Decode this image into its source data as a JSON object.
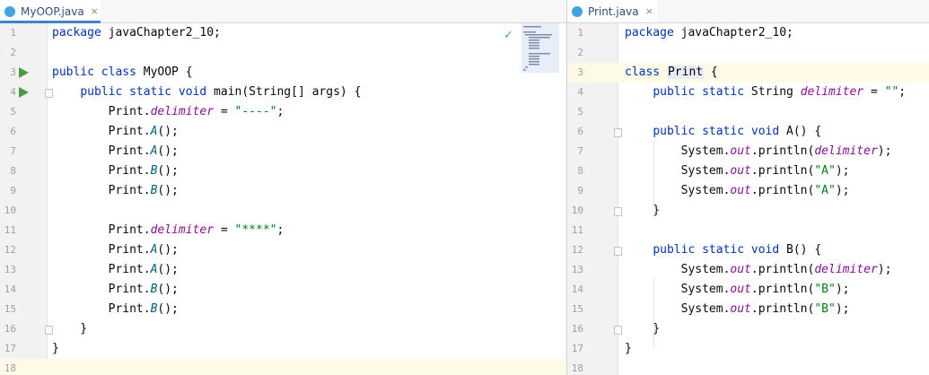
{
  "left_tab": {
    "filename": "MyOOP.java",
    "close": "×"
  },
  "right_tab": {
    "filename": "Print.java",
    "close": "×"
  },
  "left_editor": {
    "status": "✓",
    "lines": [
      {
        "n": "1",
        "tokens": [
          [
            "kw",
            "package "
          ],
          [
            "plain",
            "javaChapter2_10;"
          ]
        ]
      },
      {
        "n": "2",
        "tokens": []
      },
      {
        "n": "3",
        "run": true,
        "tokens": [
          [
            "kw",
            "public class "
          ],
          [
            "plain",
            "MyOOP {"
          ]
        ]
      },
      {
        "n": "4",
        "run": true,
        "fold": true,
        "tokens": [
          [
            "plain",
            "    "
          ],
          [
            "kw",
            "public static void "
          ],
          [
            "plain",
            "main(String[] args) {"
          ]
        ]
      },
      {
        "n": "5",
        "tokens": [
          [
            "plain",
            "        Print."
          ],
          [
            "fld",
            "delimiter"
          ],
          [
            "plain",
            " = "
          ],
          [
            "str",
            "\"----\""
          ],
          [
            "plain",
            ";"
          ]
        ]
      },
      {
        "n": "6",
        "tokens": [
          [
            "plain",
            "        Print."
          ],
          [
            "mcall",
            "A"
          ],
          [
            "plain",
            "();"
          ]
        ]
      },
      {
        "n": "7",
        "tokens": [
          [
            "plain",
            "        Print."
          ],
          [
            "mcall",
            "A"
          ],
          [
            "plain",
            "();"
          ]
        ]
      },
      {
        "n": "8",
        "tokens": [
          [
            "plain",
            "        Print."
          ],
          [
            "mcall",
            "B"
          ],
          [
            "plain",
            "();"
          ]
        ]
      },
      {
        "n": "9",
        "tokens": [
          [
            "plain",
            "        Print."
          ],
          [
            "mcall",
            "B"
          ],
          [
            "plain",
            "();"
          ]
        ]
      },
      {
        "n": "10",
        "tokens": []
      },
      {
        "n": "11",
        "tokens": [
          [
            "plain",
            "        Print."
          ],
          [
            "fld",
            "delimiter"
          ],
          [
            "plain",
            " = "
          ],
          [
            "str",
            "\"****\""
          ],
          [
            "plain",
            ";"
          ]
        ]
      },
      {
        "n": "12",
        "tokens": [
          [
            "plain",
            "        Print."
          ],
          [
            "mcall",
            "A"
          ],
          [
            "plain",
            "();"
          ]
        ]
      },
      {
        "n": "13",
        "tokens": [
          [
            "plain",
            "        Print."
          ],
          [
            "mcall",
            "A"
          ],
          [
            "plain",
            "();"
          ]
        ]
      },
      {
        "n": "14",
        "tokens": [
          [
            "plain",
            "        Print."
          ],
          [
            "mcall",
            "B"
          ],
          [
            "plain",
            "();"
          ]
        ]
      },
      {
        "n": "15",
        "tokens": [
          [
            "plain",
            "        Print."
          ],
          [
            "mcall",
            "B"
          ],
          [
            "plain",
            "();"
          ]
        ]
      },
      {
        "n": "16",
        "fold": true,
        "tokens": [
          [
            "plain",
            "    }"
          ]
        ]
      },
      {
        "n": "17",
        "tokens": [
          [
            "plain",
            "}"
          ]
        ]
      },
      {
        "n": "18",
        "current": true,
        "tokens": []
      }
    ]
  },
  "right_editor": {
    "lines": [
      {
        "n": "1",
        "tokens": [
          [
            "kw",
            "package "
          ],
          [
            "plain",
            "javaChapter2_10;"
          ]
        ]
      },
      {
        "n": "2",
        "tokens": []
      },
      {
        "n": "3",
        "current": true,
        "tokens": [
          [
            "kw",
            "class "
          ],
          [
            "cls",
            "Print"
          ],
          [
            "plain",
            " {"
          ]
        ]
      },
      {
        "n": "4",
        "tokens": [
          [
            "plain",
            "    "
          ],
          [
            "kw",
            "public static "
          ],
          [
            "plain",
            "String "
          ],
          [
            "fld",
            "delimiter"
          ],
          [
            "plain",
            " = "
          ],
          [
            "str",
            "\"\""
          ],
          [
            "plain",
            ";"
          ]
        ]
      },
      {
        "n": "5",
        "tokens": []
      },
      {
        "n": "6",
        "fold": true,
        "tokens": [
          [
            "plain",
            "    "
          ],
          [
            "kw",
            "public static void "
          ],
          [
            "plain",
            "A() {"
          ]
        ]
      },
      {
        "n": "7",
        "tokens": [
          [
            "plain",
            "        System."
          ],
          [
            "fld",
            "out"
          ],
          [
            "plain",
            ".println("
          ],
          [
            "fld",
            "delimiter"
          ],
          [
            "plain",
            ");"
          ]
        ]
      },
      {
        "n": "8",
        "tokens": [
          [
            "plain",
            "        System."
          ],
          [
            "fld",
            "out"
          ],
          [
            "plain",
            ".println("
          ],
          [
            "str",
            "\"A\""
          ],
          [
            "plain",
            ");"
          ]
        ]
      },
      {
        "n": "9",
        "tokens": [
          [
            "plain",
            "        System."
          ],
          [
            "fld",
            "out"
          ],
          [
            "plain",
            ".println("
          ],
          [
            "str",
            "\"A\""
          ],
          [
            "plain",
            ");"
          ]
        ]
      },
      {
        "n": "10",
        "fold": true,
        "tokens": [
          [
            "plain",
            "    }"
          ]
        ]
      },
      {
        "n": "11",
        "tokens": []
      },
      {
        "n": "12",
        "fold": true,
        "tokens": [
          [
            "plain",
            "    "
          ],
          [
            "kw",
            "public static void "
          ],
          [
            "plain",
            "B() {"
          ]
        ]
      },
      {
        "n": "13",
        "tokens": [
          [
            "plain",
            "        System."
          ],
          [
            "fld",
            "out"
          ],
          [
            "plain",
            ".println("
          ],
          [
            "fld",
            "delimiter"
          ],
          [
            "plain",
            ");"
          ]
        ]
      },
      {
        "n": "14",
        "tokens": [
          [
            "plain",
            "        System."
          ],
          [
            "fld",
            "out"
          ],
          [
            "plain",
            ".println("
          ],
          [
            "str",
            "\"B\""
          ],
          [
            "plain",
            ");"
          ]
        ]
      },
      {
        "n": "15",
        "tokens": [
          [
            "plain",
            "        System."
          ],
          [
            "fld",
            "out"
          ],
          [
            "plain",
            ".println("
          ],
          [
            "str",
            "\"B\""
          ],
          [
            "plain",
            ");"
          ]
        ]
      },
      {
        "n": "16",
        "fold": true,
        "tokens": [
          [
            "plain",
            "    }"
          ]
        ]
      },
      {
        "n": "17",
        "tokens": [
          [
            "plain",
            "}"
          ]
        ]
      },
      {
        "n": "18",
        "tokens": []
      }
    ]
  }
}
